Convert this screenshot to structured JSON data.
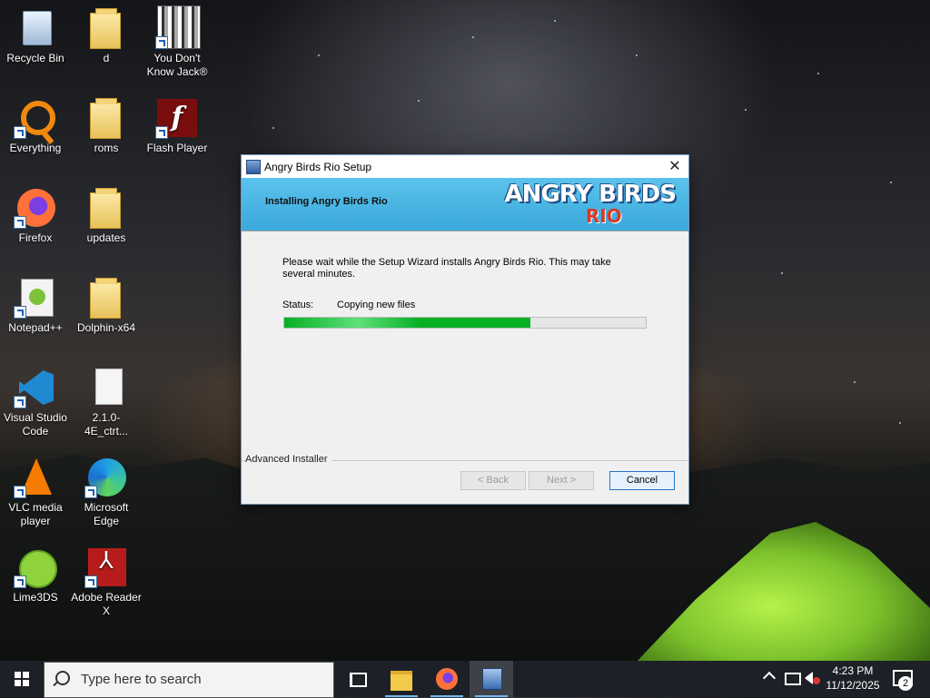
{
  "desktop": {
    "icons": [
      {
        "label": "Recycle Bin"
      },
      {
        "label": "d"
      },
      {
        "label": "You Don't Know Jack®"
      },
      {
        "label": "Everything"
      },
      {
        "label": "roms"
      },
      {
        "label": "Flash Player"
      },
      {
        "label": "Firefox"
      },
      {
        "label": "updates"
      },
      {
        "label": "Notepad++"
      },
      {
        "label": "Dolphin-x64"
      },
      {
        "label": "Visual Studio Code"
      },
      {
        "label": "2.1.0-4E_ctrt..."
      },
      {
        "label": "VLC media player"
      },
      {
        "label": "Microsoft Edge"
      },
      {
        "label": "Lime3DS"
      },
      {
        "label": "Adobe Reader X"
      }
    ]
  },
  "dialog": {
    "title": "Angry Birds Rio Setup",
    "close_symbol": "✕",
    "banner_heading": "Installing Angry Birds Rio",
    "logo_line1": "ANGRY BIRDS",
    "logo_line2": "RIO",
    "message": "Please wait while the Setup Wizard installs Angry Birds Rio.  This may take several minutes.",
    "status_label": "Status:",
    "status_value": "Copying new files",
    "progress_percent": 68,
    "brand": "Advanced Installer",
    "buttons": {
      "back": "< Back",
      "next": "Next >",
      "cancel": "Cancel"
    }
  },
  "taskbar": {
    "search_placeholder": "Type here to search",
    "time": "4:23 PM",
    "date": "11/12/2025",
    "notification_count": "2"
  }
}
